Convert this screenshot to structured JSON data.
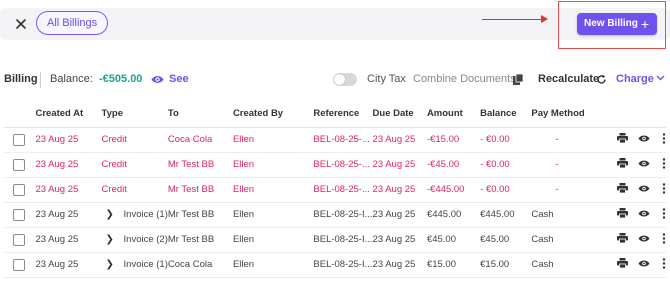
{
  "filter": {
    "pill_label": "All Billings"
  },
  "new_billing_label": "New Billing",
  "new_billing_plus": "+",
  "toolbar": {
    "title": "Billing",
    "balance_label": "Balance:",
    "balance_value": "-€505.00",
    "see_label": "See",
    "city_tax_label": "City Tax",
    "combine_label": "Combine Documents",
    "recalculate_label": "Recalculate",
    "charge_label": "Charge"
  },
  "table": {
    "headers": [
      "Created At",
      "Type",
      "To",
      "Created By",
      "Reference",
      "Due Date",
      "Amount",
      "Balance",
      "Pay Method"
    ],
    "rows": [
      {
        "kind": "credit",
        "created_at": "23 Aug 25",
        "type": "Credit",
        "to": "Coca Cola",
        "created_by": "Ellen",
        "reference": "BEL-08-25-...",
        "due_date": "23 Aug 25",
        "amount": "-€15.00",
        "balance": "- €0.00",
        "pay_method": "-"
      },
      {
        "kind": "credit",
        "created_at": "23 Aug 25",
        "type": "Credit",
        "to": "Mr Test BB",
        "created_by": "Ellen",
        "reference": "BEL-08-25-...",
        "due_date": "23 Aug 25",
        "amount": "-€45.00",
        "balance": "- €0.00",
        "pay_method": "-"
      },
      {
        "kind": "credit",
        "created_at": "23 Aug 25",
        "type": "Credit",
        "to": "Mr Test BB",
        "created_by": "Ellen",
        "reference": "BEL-08-25-...",
        "due_date": "23 Aug 25",
        "amount": "-€445.00",
        "balance": "- €0.00",
        "pay_method": "-"
      },
      {
        "kind": "invoice",
        "created_at": "23 Aug 25",
        "type": "Invoice (1)",
        "to": "Mr Test BB",
        "created_by": "Ellen",
        "reference": "BEL-08-25-I...",
        "due_date": "23 Aug 25",
        "amount": "€445.00",
        "balance": "€445.00",
        "pay_method": "Cash"
      },
      {
        "kind": "invoice",
        "created_at": "23 Aug 25",
        "type": "Invoice (2)",
        "to": "Mr Test BB",
        "created_by": "Ellen",
        "reference": "BEL-08-25-I...",
        "due_date": "23 Aug 25",
        "amount": "€45.00",
        "balance": "€45.00",
        "pay_method": "Cash"
      },
      {
        "kind": "invoice",
        "created_at": "23 Aug 25",
        "type": "Invoice (1)",
        "to": "Coca Cola",
        "created_by": "Ellen",
        "reference": "BEL-08-25-I...",
        "due_date": "23 Aug 25",
        "amount": "€15.00",
        "balance": "€15.00",
        "pay_method": "Cash"
      }
    ]
  },
  "icons": {
    "close": "close-icon",
    "eye": "eye-icon",
    "document": "document-icon",
    "refresh": "refresh-icon",
    "chevron": "chevron-down-icon",
    "print": "print-icon",
    "more": "more-icon",
    "expand": "chevron-right-icon"
  },
  "colors": {
    "accent": "#6f52ee",
    "credit": "#e0245e",
    "balance": "#1aa58e"
  }
}
